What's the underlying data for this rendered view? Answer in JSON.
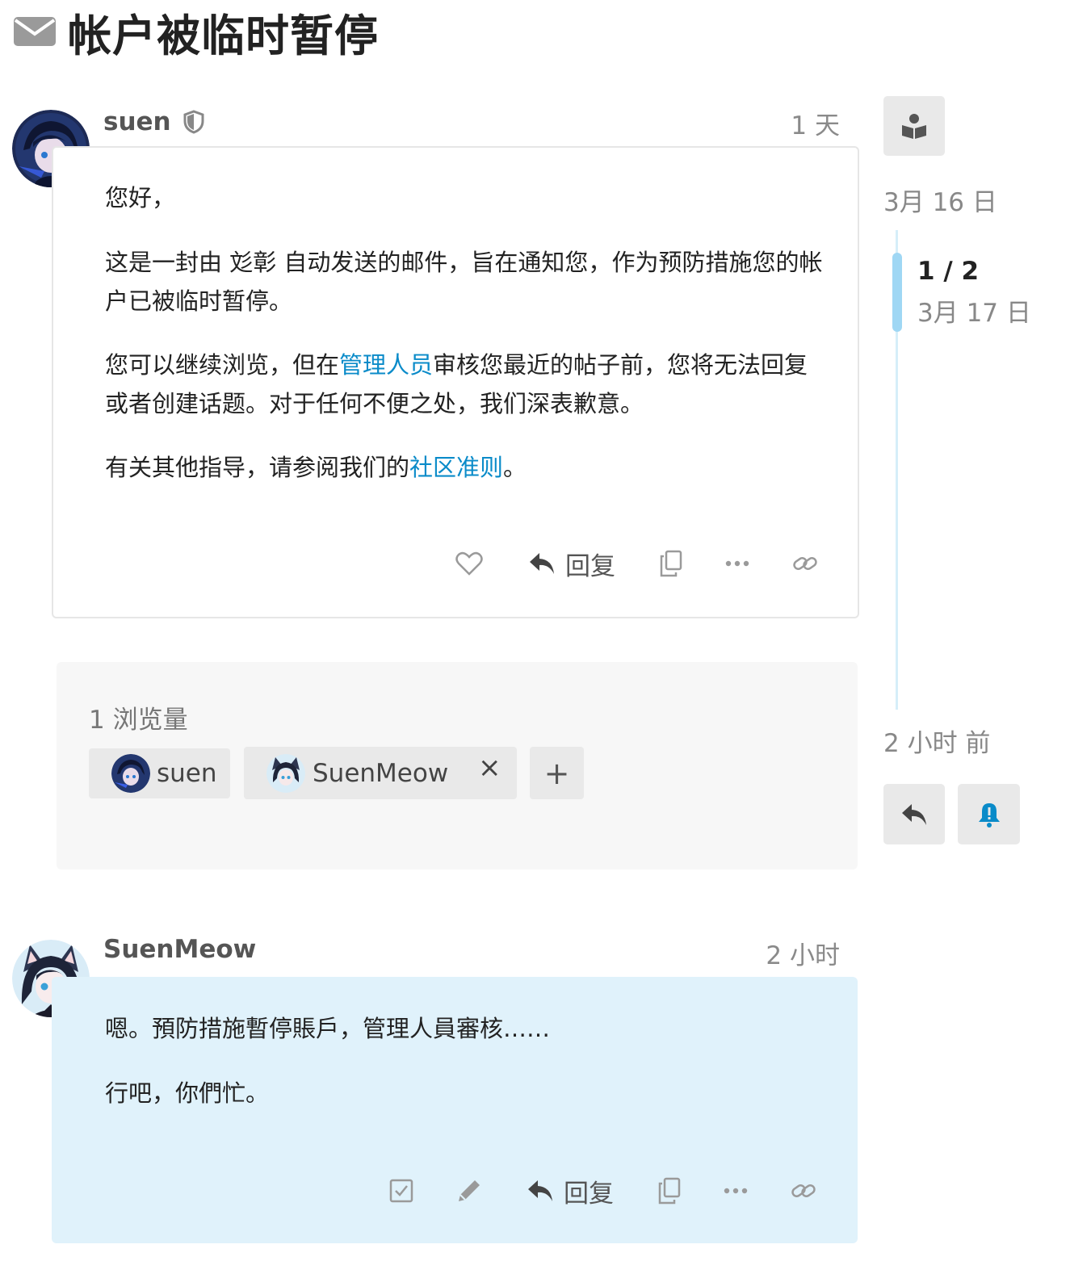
{
  "topic": {
    "title": "帐户被临时暂停",
    "icon": "envelope-icon"
  },
  "posts": [
    {
      "username": "suen",
      "user_badge_icon": "shield-icon",
      "date": "1 天",
      "paragraphs": {
        "greeting": "您好，",
        "p1": "这是一封由 彣彰 自动发送的邮件，旨在通知您，作为预防措施您的帐户已被临时暂停。",
        "p2_before": "您可以继续浏览，但在",
        "p2_link": "管理人员",
        "p2_after": "审核您最近的帖子前，您将无法回复或者创建话题。对于任何不便之处，我们深表歉意。",
        "p3_before": "有关其他指导，请参阅我们的",
        "p3_link": "社区准则",
        "p3_after": "。"
      },
      "actions": {
        "like_icon": "heart-icon",
        "reply_label": "回复",
        "copy_icon": "copy-icon",
        "more_icon": "ellipsis-icon",
        "link_icon": "link-icon"
      }
    },
    {
      "username": "SuenMeow",
      "date": "2 小时",
      "paragraphs": {
        "p1": "嗯。預防措施暫停賬戶，管理人員審核……",
        "p2": "行吧，你們忙。"
      },
      "actions": {
        "solve_icon": "check-square-icon",
        "edit_icon": "pencil-icon",
        "reply_label": "回复",
        "copy_icon": "copy-icon",
        "more_icon": "ellipsis-icon",
        "link_icon": "link-icon"
      }
    }
  ],
  "summary": {
    "views": "1 浏览量",
    "participants": [
      {
        "name": "suen"
      },
      {
        "name": "SuenMeow",
        "remove_label": "×"
      }
    ],
    "add_label": "+"
  },
  "timeline": {
    "toggle_icon": "book-reader-icon",
    "start_date": "3月 16 日",
    "position": "1 / 2",
    "current_date": "3月 17 日",
    "end_date": "2 小时 前",
    "reply_icon": "reply-icon",
    "notify_icon": "bell-alert-icon"
  },
  "colors": {
    "accent": "#0a8bc9",
    "highlight_post_bg": "#e0f2fb",
    "timeline_handle": "#9fd7f4"
  }
}
